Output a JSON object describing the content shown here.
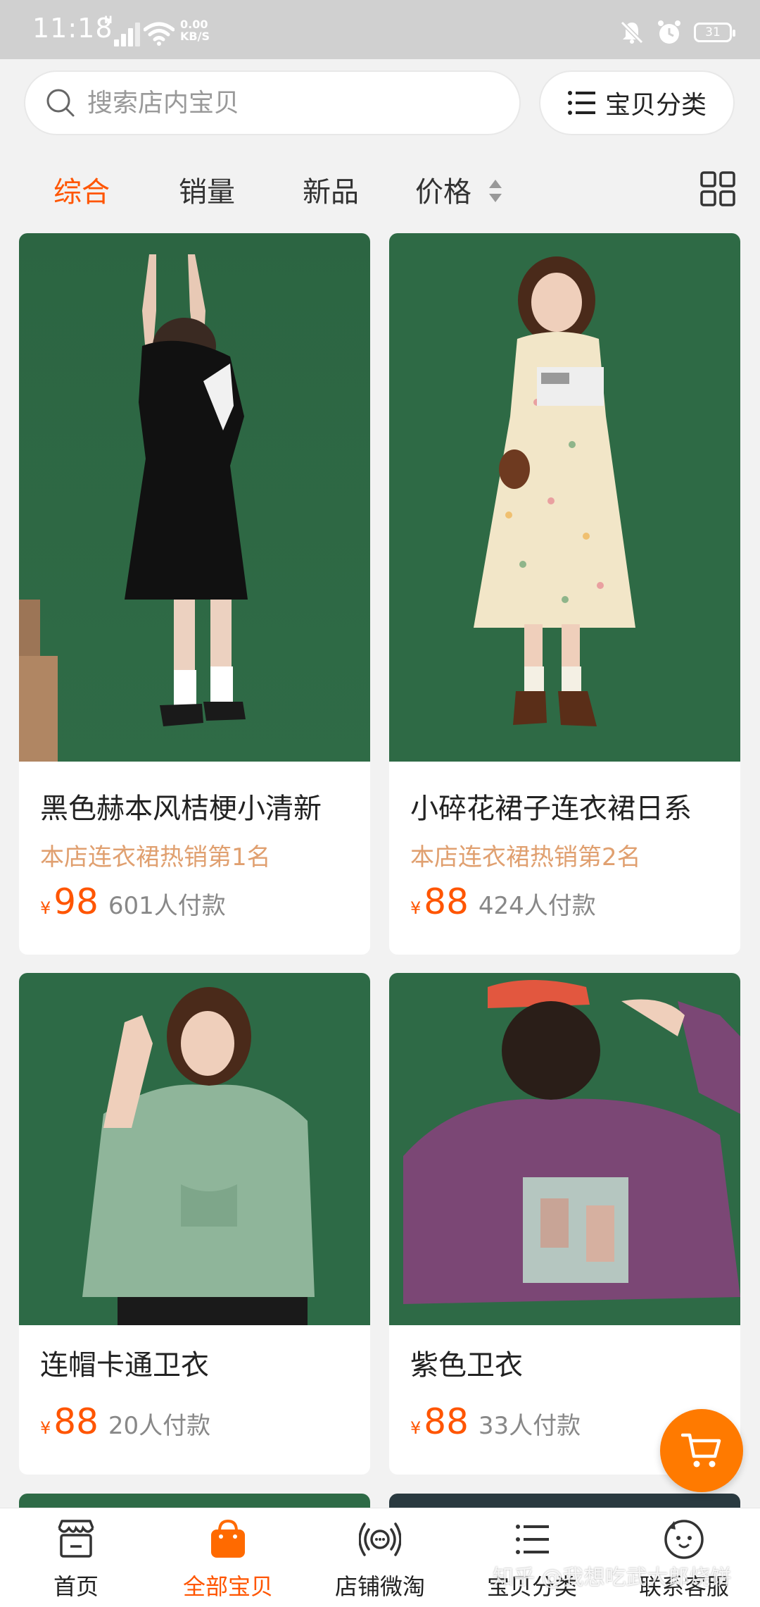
{
  "status_bar": {
    "time": "11:18",
    "network_badge": "H",
    "speed_value": "0.00",
    "speed_unit": "KB/S",
    "battery": "31",
    "icons": [
      "signal-icon",
      "wifi-icon",
      "mute-icon",
      "alarm-icon",
      "battery-icon"
    ]
  },
  "search": {
    "placeholder": "搜索店内宝贝",
    "category_button": "宝贝分类"
  },
  "sort_tabs": [
    {
      "label": "综合",
      "active": true
    },
    {
      "label": "销量",
      "active": false
    },
    {
      "label": "新品",
      "active": false
    },
    {
      "label": "价格",
      "active": false
    }
  ],
  "products": [
    {
      "title": "黑色赫本风桔梗小清新",
      "rank": "本店连衣裙热销第1名",
      "currency": "¥",
      "price": "98",
      "sales": "601人付款"
    },
    {
      "title": "小碎花裙子连衣裙日系",
      "rank": "本店连衣裙热销第2名",
      "currency": "¥",
      "price": "88",
      "sales": "424人付款"
    },
    {
      "title": "连帽卡通卫衣",
      "rank": "",
      "currency": "¥",
      "price": "88",
      "sales": "20人付款"
    },
    {
      "title": "紫色卫衣",
      "rank": "",
      "currency": "¥",
      "price": "88",
      "sales": "33人付款"
    }
  ],
  "bottom_nav": [
    {
      "label": "首页",
      "icon": "store-icon",
      "active": false
    },
    {
      "label": "全部宝贝",
      "icon": "shopping-bag-icon",
      "active": true
    },
    {
      "label": "店铺微淘",
      "icon": "broadcast-icon",
      "active": false
    },
    {
      "label": "宝贝分类",
      "icon": "list-icon",
      "active": false
    },
    {
      "label": "联系客服",
      "icon": "chat-face-icon",
      "active": false
    }
  ],
  "watermark": "知乎 @我想吃武大郎烧饼",
  "colors": {
    "accent": "#ff5500",
    "rank_text": "#e0a070",
    "cart_button": "#ff7a00",
    "photo_backdrop": "#2f6a45"
  }
}
